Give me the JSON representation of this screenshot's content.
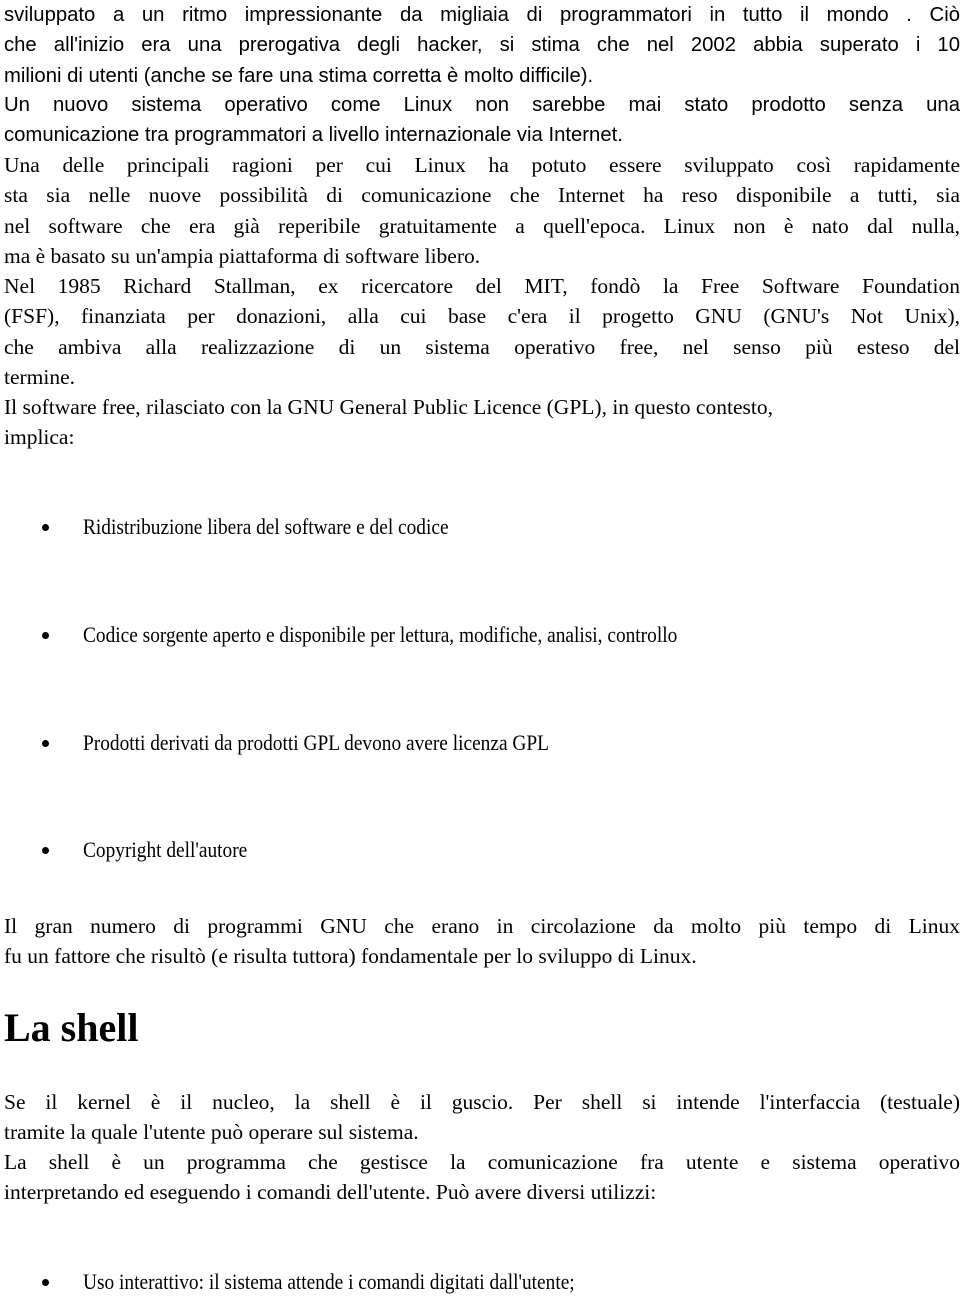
{
  "document": {
    "paragraphs": [
      {
        "id": "intro-growth",
        "lines": [
          "sviluppato a un ritmo impressionante da migliaia di programmatori in tutto il mondo . Ciò",
          "che all'inizio era una prerogativa degli hacker, si stima che nel 2002 abbia superato i 10",
          "milioni di utenti (anche se fare una stima corretta è molto difficile)."
        ]
      },
      {
        "id": "internet-communication",
        "lines": [
          "Un nuovo sistema operativo come Linux non sarebbe mai stato prodotto senza una",
          "comunicazione tra programmatori a livello internazionale via Internet."
        ]
      },
      {
        "id": "reasons",
        "lines": [
          "Una delle principali ragioni per cui Linux ha potuto essere sviluppato così rapidamente",
          "sta sia nelle nuove possibilità di comunicazione che Internet ha reso disponibile a tutti, sia",
          "nel software che era già reperibile gratuitamente a quell'epoca. Linux non è nato dal nulla,",
          "ma è basato su un'ampia piattaforma di software libero."
        ]
      },
      {
        "id": "fsf",
        "lines": [
          "Nel 1985 Richard Stallman, ex ricercatore del MIT, fondò la Free Software Foundation",
          "(FSF), finanziata per donazioni, alla cui base c'era il progetto GNU (GNU's Not Unix),",
          "che ambiva alla realizzazione di un sistema operativo free, nel senso più esteso del",
          "termine."
        ]
      },
      {
        "id": "gpl-intro",
        "lines": [
          "Il software free, rilasciato con la GNU General Public Licence (GPL), in questo contesto,",
          "implica:"
        ]
      }
    ],
    "gpl_list": [
      "Ridistribuzione libera del software e del codice",
      "Codice sorgente aperto e disponibile per lettura, modifiche, analisi, controllo",
      "Prodotti derivati da prodotti GPL devono avere licenza GPL",
      "Copyright dell'autore"
    ],
    "gnu_paragraph": {
      "lines": [
        "Il gran numero di programmi GNU che erano in circolazione da molto più tempo di Linux",
        "fu un fattore che risultò (e risulta tuttora) fondamentale per lo sviluppo di Linux."
      ]
    },
    "section_heading": "La shell",
    "shell_paragraphs": [
      {
        "id": "shell-definition",
        "lines": [
          "Se il kernel è il nucleo, la shell è il guscio. Per shell si intende l'interfaccia (testuale)",
          "tramite la quale l'utente può operare sul sistema."
        ]
      },
      {
        "id": "shell-program",
        "lines": [
          "La shell è un programma che gestisce la comunicazione fra utente e sistema operativo",
          "interpretando ed eseguendo i comandi dell'utente. Può avere diversi utilizzi:"
        ]
      }
    ],
    "shell_list": [
      "Uso interattivo: il sistema attende i comandi digitati dall'utente;"
    ]
  }
}
